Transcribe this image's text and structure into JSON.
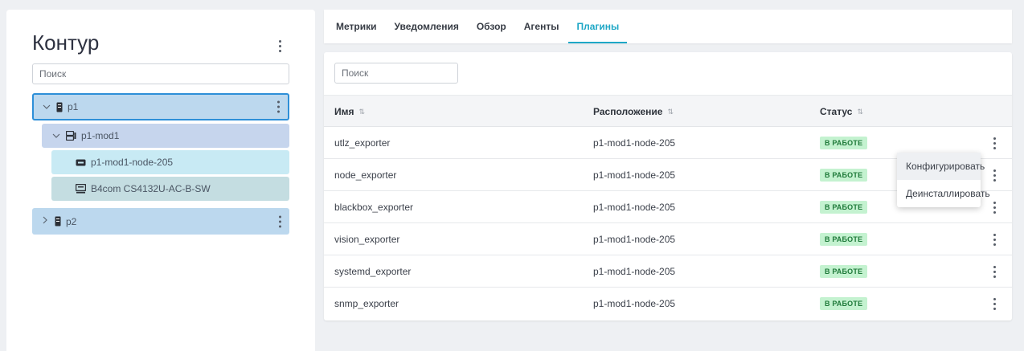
{
  "sidebar": {
    "title": "Контур",
    "search_placeholder": "Поиск",
    "tree": {
      "p1": "p1",
      "p1_mod1": "p1-mod1",
      "node": "p1-mod1-node-205",
      "switch": "B4com CS4132U-AC-B-SW",
      "p2": "p2"
    }
  },
  "tabs": [
    {
      "label": "Метрики"
    },
    {
      "label": "Уведомления"
    },
    {
      "label": "Обзор"
    },
    {
      "label": "Агенты"
    },
    {
      "label": "Плагины",
      "active": true
    }
  ],
  "main": {
    "search_placeholder": "Поиск",
    "columns": {
      "name": "Имя",
      "location": "Расположение",
      "status": "Статус"
    },
    "sort_icon": "⇅",
    "rows": [
      {
        "name": "utlz_exporter",
        "location": "p1-mod1-node-205",
        "status": "В РАБОТЕ"
      },
      {
        "name": "node_exporter",
        "location": "p1-mod1-node-205",
        "status": "В РАБОТЕ"
      },
      {
        "name": "blackbox_exporter",
        "location": "p1-mod1-node-205",
        "status": "В РАБОТЕ"
      },
      {
        "name": "vision_exporter",
        "location": "p1-mod1-node-205",
        "status": "В РАБОТЕ"
      },
      {
        "name": "systemd_exporter",
        "location": "p1-mod1-node-205",
        "status": "В РАБОТЕ"
      },
      {
        "name": "snmp_exporter",
        "location": "p1-mod1-node-205",
        "status": "В РАБОТЕ"
      }
    ]
  },
  "context_menu": {
    "configure": "Конфигурировать",
    "uninstall": "Деинсталлировать"
  },
  "colors": {
    "accent": "#1ea7c6",
    "status_bg": "#c4f2d0",
    "status_text": "#1f7a3a",
    "selected_border": "#2d8fd8"
  }
}
